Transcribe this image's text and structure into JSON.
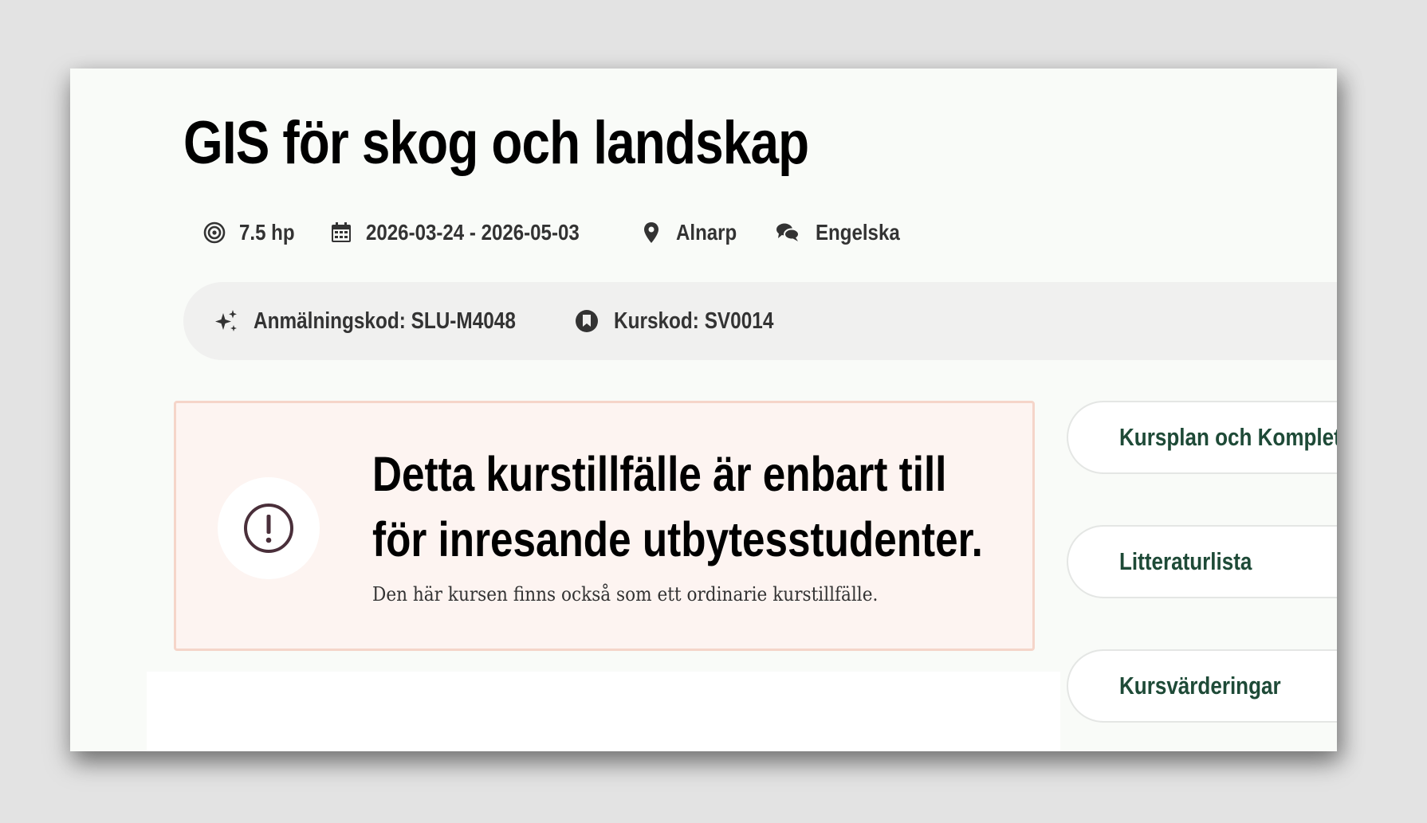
{
  "course": {
    "title": "GIS för skog och landskap"
  },
  "meta": {
    "credits": "7.5 hp",
    "dates": "2026-03-24 - 2026-05-03",
    "location": "Alnarp",
    "language": "Engelska",
    "icons": [
      "target-icon",
      "calendar-icon",
      "location-pin-icon",
      "chat-bubbles-icon"
    ]
  },
  "codes": {
    "application_code": "Anmälningskod: SLU-M4048",
    "course_code": "Kurskod: SV0014",
    "icons": [
      "sparkle-icon",
      "bookmark-icon"
    ]
  },
  "notice": {
    "heading": "Detta kurstillfälle är enbart till för inresande utbytesstudenter.",
    "text": "Den här kursen finns också som ett ordinarie kurstillfälle.",
    "icon": "exclamation-circle-icon"
  },
  "side_links": [
    {
      "label": "Kursplan och Komplet"
    },
    {
      "label": "Litteraturlista"
    },
    {
      "label": "Kursvärderingar"
    }
  ],
  "colors": {
    "page_background": "#f9fbf8",
    "notice_background": "#fdf4f1",
    "notice_border": "#f5d5c9",
    "link_text": "#1e4a37",
    "code_bar_background": "#f0f0ef"
  }
}
